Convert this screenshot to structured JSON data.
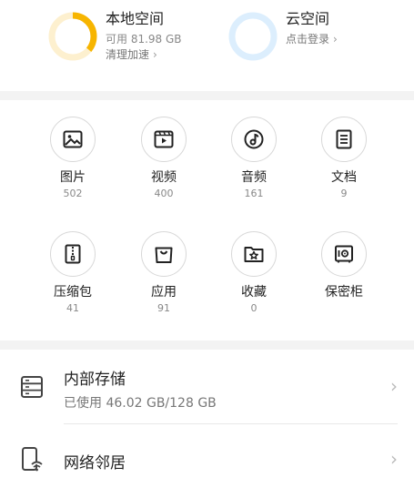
{
  "storage_cards": {
    "local": {
      "title": "本地空间",
      "available": "可用 81.98 GB",
      "action": "清理加速",
      "used_fraction": 0.36,
      "color": "#f7b500"
    },
    "cloud": {
      "title": "云空间",
      "action": "点击登录",
      "color": "#cfe5fb"
    }
  },
  "categories": [
    {
      "label": "图片",
      "count": "502",
      "icon": "image-icon"
    },
    {
      "label": "视频",
      "count": "400",
      "icon": "video-icon"
    },
    {
      "label": "音频",
      "count": "161",
      "icon": "audio-icon"
    },
    {
      "label": "文档",
      "count": "9",
      "icon": "document-icon"
    },
    {
      "label": "压缩包",
      "count": "41",
      "icon": "archive-icon"
    },
    {
      "label": "应用",
      "count": "91",
      "icon": "app-bag-icon"
    },
    {
      "label": "收藏",
      "count": "0",
      "icon": "star-folder-icon"
    },
    {
      "label": "保密柜",
      "icon": "safe-icon"
    }
  ],
  "storage_list": {
    "internal": {
      "title": "内部存储",
      "usage": "已使用 46.02 GB/128 GB"
    },
    "network": {
      "title": "网络邻居"
    }
  }
}
